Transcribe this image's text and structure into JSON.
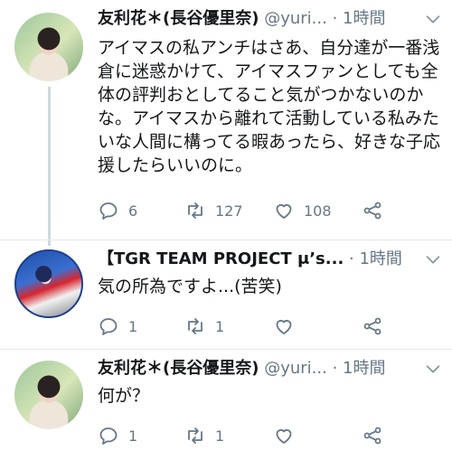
{
  "tweets": [
    {
      "name": "友利花＊(長谷優里奈)",
      "handle": "@yuri...",
      "sep": "·",
      "time": "1時間",
      "text": "アイマスの私アンチはさあ、自分達が一番浅倉に迷惑かけて、アイマスファンとしても全体の評判おとしてること気がつかないのかな。アイマスから離れて活動している私みたいな人間に構ってる暇あったら、好きな子応援したらいいのに。",
      "replies": "6",
      "retweets": "127",
      "likes": "108"
    },
    {
      "name": "【TGR TEAM PROJECT μ’s...",
      "sep": "·",
      "time": "1時間",
      "text": "気の所為ですよ...(苦笑)",
      "replies": "1",
      "retweets": "1",
      "likes": ""
    },
    {
      "name": "友利花＊(長谷優里奈)",
      "handle": "@yuri...",
      "sep": "·",
      "time": "1時間",
      "text": "何が？",
      "replies": "1",
      "retweets": "1",
      "likes": ""
    }
  ],
  "colors": {
    "icon_gray": "#657786",
    "text": "#14171a",
    "thread_line": "#cfd9de"
  },
  "icons": [
    "reply-icon",
    "retweet-icon",
    "like-icon",
    "share-icon",
    "chevron-down-icon"
  ]
}
